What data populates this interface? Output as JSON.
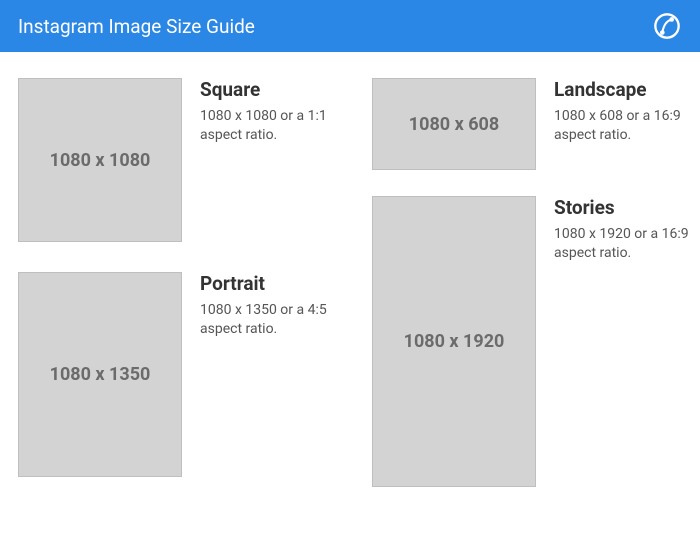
{
  "header": {
    "title": "Instagram Image Size Guide"
  },
  "specs": {
    "square": {
      "title": "Square",
      "dimensions": "1080 x 1080",
      "description": "1080 x 1080 or a 1:1 aspect ratio."
    },
    "portrait": {
      "title": "Portrait",
      "dimensions": "1080 x 1350",
      "description": "1080 x 1350 or a 4:5 aspect ratio."
    },
    "landscape": {
      "title": "Landscape",
      "dimensions": "1080 x 608",
      "description": "1080 x 608 or a 16:9 aspect ratio."
    },
    "stories": {
      "title": "Stories",
      "dimensions": "1080 x 1920",
      "description": "1080 x 1920 or a 16:9 aspect ratio."
    }
  }
}
